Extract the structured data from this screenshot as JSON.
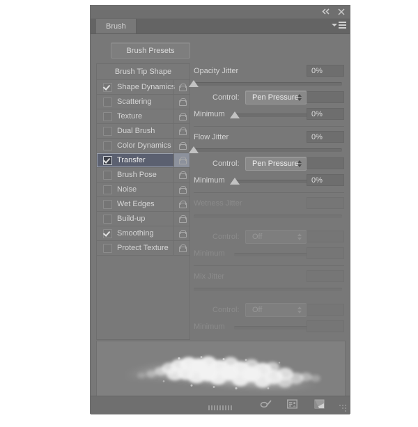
{
  "window": {
    "title": "Brush",
    "collapse_icon": "double-left-arrow-icon",
    "close_icon": "close-icon",
    "menu_icon": "panel-menu-icon"
  },
  "toolbar": {
    "brush_presets_label": "Brush Presets"
  },
  "sidebar": {
    "header": "Brush Tip Shape",
    "items": [
      {
        "label": "Shape Dynamics",
        "checked": true,
        "selected": false,
        "lock": "unlocked-icon"
      },
      {
        "label": "Scattering",
        "checked": false,
        "selected": false,
        "lock": "unlocked-icon"
      },
      {
        "label": "Texture",
        "checked": false,
        "selected": false,
        "lock": "unlocked-icon"
      },
      {
        "label": "Dual Brush",
        "checked": false,
        "selected": false,
        "lock": "unlocked-icon"
      },
      {
        "label": "Color Dynamics",
        "checked": false,
        "selected": false,
        "lock": "unlocked-icon"
      },
      {
        "label": "Transfer",
        "checked": true,
        "selected": true,
        "lock": "unlocked-icon"
      },
      {
        "label": "Brush Pose",
        "checked": false,
        "selected": false,
        "lock": "unlocked-icon"
      },
      {
        "label": "Noise",
        "checked": false,
        "selected": false,
        "lock": "unlocked-icon"
      },
      {
        "label": "Wet Edges",
        "checked": false,
        "selected": false,
        "lock": "unlocked-icon"
      },
      {
        "label": "Build-up",
        "checked": false,
        "selected": false,
        "lock": "unlocked-icon"
      },
      {
        "label": "Smoothing",
        "checked": true,
        "selected": false,
        "lock": "unlocked-icon"
      },
      {
        "label": "Protect Texture",
        "checked": false,
        "selected": false,
        "lock": "unlocked-icon"
      }
    ]
  },
  "settings": {
    "opacity_jitter": {
      "label": "Opacity Jitter",
      "value": "0%",
      "slider_percent": 0,
      "control_label": "Control:",
      "control_value": "Pen Pressure",
      "minimum_label": "Minimum",
      "minimum_value": "0%",
      "minimum_slider_percent": 0,
      "enabled": true
    },
    "flow_jitter": {
      "label": "Flow Jitter",
      "value": "0%",
      "slider_percent": 0,
      "control_label": "Control:",
      "control_value": "Pen Pressure",
      "minimum_label": "Minimum",
      "minimum_value": "0%",
      "minimum_slider_percent": 0,
      "enabled": true
    },
    "wetness_jitter": {
      "label": "Wetness Jitter",
      "value": "",
      "slider_percent": 0,
      "control_label": "Control:",
      "control_value": "Off",
      "minimum_label": "Minimum",
      "minimum_value": "",
      "minimum_slider_percent": 0,
      "enabled": false
    },
    "mix_jitter": {
      "label": "Mix Jitter",
      "value": "",
      "slider_percent": 0,
      "control_label": "Control:",
      "control_value": "Off",
      "minimum_label": "Minimum",
      "minimum_value": "",
      "minimum_slider_percent": 0,
      "enabled": false
    }
  },
  "preview": {
    "name": "brush-stroke-preview"
  },
  "footer": {
    "icons": [
      {
        "name": "toggle-brush-options-icon"
      },
      {
        "name": "new-preset-icon"
      },
      {
        "name": "new-brush-icon"
      }
    ],
    "resize_grip": "resize-grip-icon",
    "drag_grip": "drag-grip-icon"
  },
  "colors": {
    "panel_bg": "#787878",
    "list_bg": "#797979",
    "selected_row": "#5b6070",
    "text": "#d5d5d5",
    "dim_text": "#8b8b8b"
  }
}
